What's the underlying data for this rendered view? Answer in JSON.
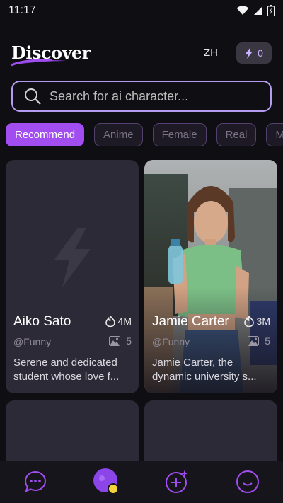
{
  "status": {
    "time": "11:17"
  },
  "header": {
    "brand": "Discover",
    "lang": "ZH",
    "credits": "0"
  },
  "search": {
    "placeholder": "Search for ai character..."
  },
  "tabs": [
    "Recommend",
    "Anime",
    "Female",
    "Real",
    "Ma"
  ],
  "cards": [
    {
      "name": "Aiko Sato",
      "popularity": "4M",
      "handle": "@Funny",
      "images": "5",
      "desc_line1": "Serene and dedicated",
      "desc_line2": "student whose love f..."
    },
    {
      "name": "Jamie Carter",
      "popularity": "3M",
      "handle": "@Funny",
      "images": "5",
      "desc_line1": "Jamie Carter, the",
      "desc_line2": "dynamic university s..."
    }
  ],
  "nav": [
    "chat-icon",
    "profile-avatar",
    "create-icon",
    "smile-icon"
  ],
  "colors": {
    "accent": "#a24df0",
    "card": "#2c2a36",
    "background": "#0f0e12"
  }
}
